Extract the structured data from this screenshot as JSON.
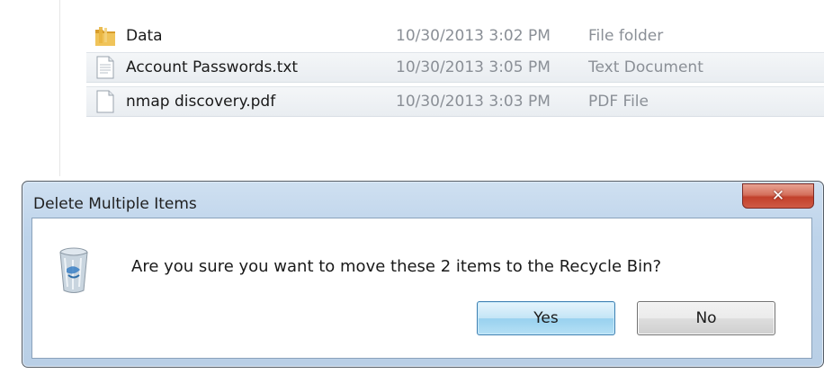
{
  "explorer": {
    "files": [
      {
        "name": "Data",
        "date": "10/30/2013 3:02 PM",
        "type": "File folder",
        "icon": "folder-icon"
      },
      {
        "name": "Account Passwords.txt",
        "date": "10/30/2013 3:05 PM",
        "type": "Text Document",
        "icon": "text-document-icon"
      },
      {
        "name": "nmap discovery.pdf",
        "date": "10/30/2013 3:03 PM",
        "type": "PDF File",
        "icon": "pdf-document-icon"
      }
    ]
  },
  "dialog": {
    "title": "Delete Multiple Items",
    "close_icon": "close-icon",
    "message": "Are you sure you want to move these 2 items to the Recycle Bin?",
    "icon": "recycle-bin-icon",
    "yes_label": "Yes",
    "no_label": "No"
  },
  "colors": {
    "close_button": "#c2402b",
    "dialog_frame": "#bdd3ea",
    "folder": "#e9b640"
  }
}
